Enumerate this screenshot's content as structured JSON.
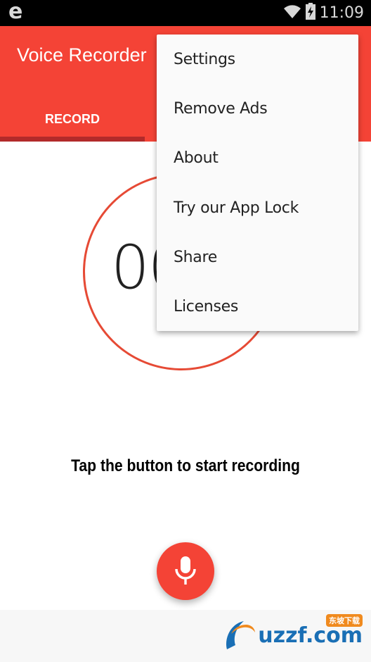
{
  "status_bar": {
    "notification_icon": "e-logo-icon",
    "wifi_icon": "wifi-icon",
    "battery_icon": "battery-charging-icon",
    "time": "11:09",
    "notification_glyph": "e"
  },
  "app_bar": {
    "title": "Voice Recorder",
    "tabs": [
      {
        "label": "RECORD",
        "active": true
      }
    ],
    "accent_color": "#f44336"
  },
  "recorder": {
    "timer": "00:00",
    "hint": "Tap the button to start recording",
    "mic_button_icon": "microphone-icon"
  },
  "overflow_menu": {
    "items": [
      {
        "label": "Settings"
      },
      {
        "label": "Remove Ads"
      },
      {
        "label": "About"
      },
      {
        "label": "Try our App Lock"
      },
      {
        "label": "Share"
      },
      {
        "label": "Licenses"
      }
    ]
  },
  "watermark": {
    "text": "uzzf.com",
    "chinese_label": "东坡下载"
  }
}
